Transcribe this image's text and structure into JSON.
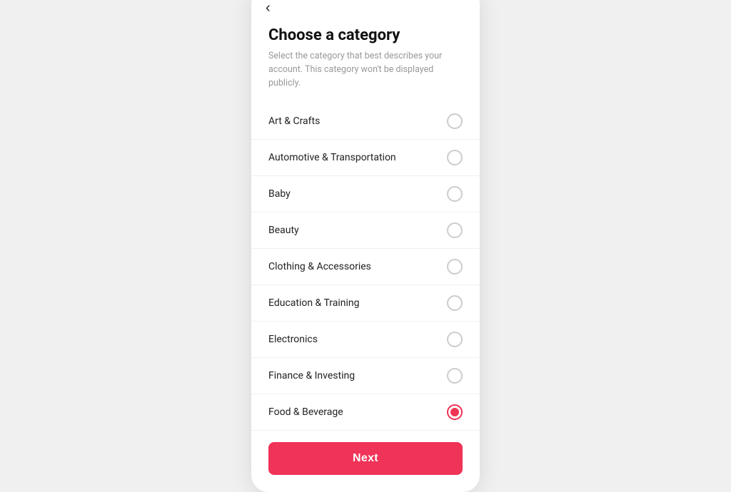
{
  "page": {
    "title": "Choose a category",
    "subtitle": "Select the category that best describes your account. This category won't be displayed publicly.",
    "back_label": "<"
  },
  "categories": [
    {
      "id": "art-crafts",
      "label": "Art & Crafts",
      "selected": false
    },
    {
      "id": "automotive",
      "label": "Automotive & Transportation",
      "selected": false
    },
    {
      "id": "baby",
      "label": "Baby",
      "selected": false
    },
    {
      "id": "beauty",
      "label": "Beauty",
      "selected": false
    },
    {
      "id": "clothing",
      "label": "Clothing & Accessories",
      "selected": false
    },
    {
      "id": "education",
      "label": "Education & Training",
      "selected": false
    },
    {
      "id": "electronics",
      "label": "Electronics",
      "selected": false
    },
    {
      "id": "finance",
      "label": "Finance & Investing",
      "selected": false
    },
    {
      "id": "food",
      "label": "Food & Beverage",
      "selected": true
    }
  ],
  "next_button": {
    "label": "Next"
  }
}
